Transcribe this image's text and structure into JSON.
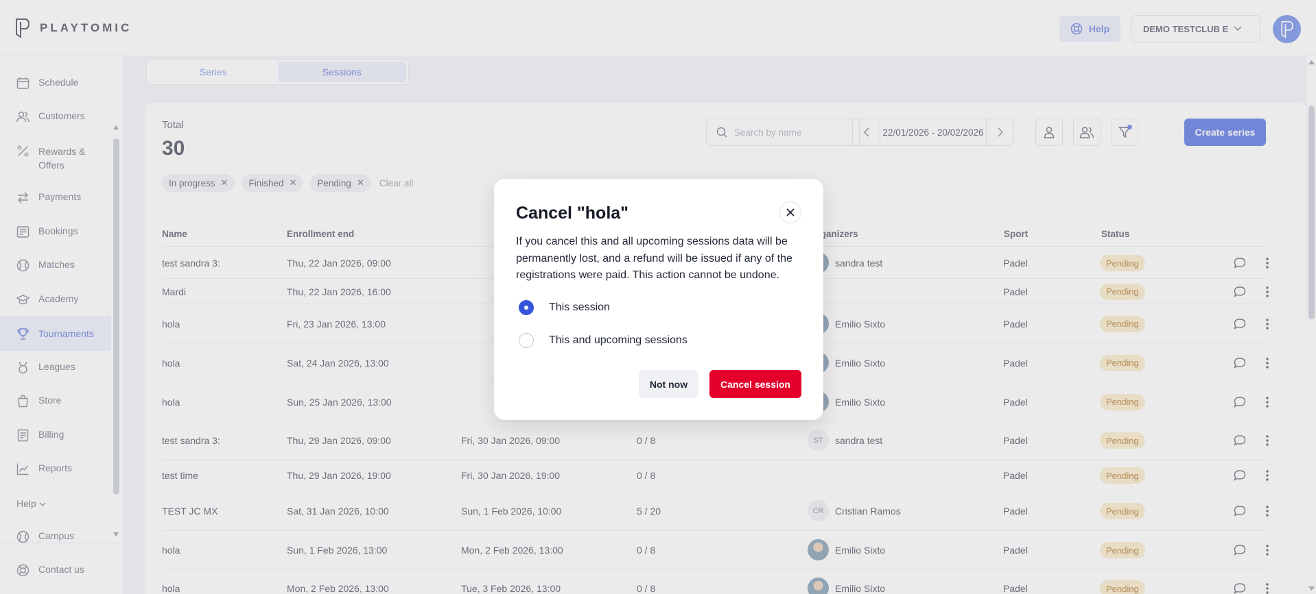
{
  "brand": {
    "name": "PLAYTOMIC"
  },
  "header": {
    "help_label": "Help",
    "club_label": "DEMO TESTCLUB E"
  },
  "sidebar": {
    "items": [
      {
        "label": "Schedule",
        "icon": "calendar-icon"
      },
      {
        "label": "Customers",
        "icon": "users-icon"
      },
      {
        "label": "Rewards &\nOffers",
        "icon": "percent-icon"
      },
      {
        "label": "Payments",
        "icon": "transfer-icon"
      },
      {
        "label": "Bookings",
        "icon": "bookings-icon"
      },
      {
        "label": "Matches",
        "icon": "ball-icon"
      },
      {
        "label": "Academy",
        "icon": "academy-icon"
      },
      {
        "label": "Tournaments",
        "icon": "trophy-icon"
      },
      {
        "label": "Leagues",
        "icon": "medal-icon"
      },
      {
        "label": "Store",
        "icon": "bag-icon"
      },
      {
        "label": "Billing",
        "icon": "billing-icon"
      },
      {
        "label": "Reports",
        "icon": "chart-icon"
      }
    ],
    "active_item": "Tournaments",
    "help_section": "Help",
    "bottom_items": [
      {
        "label": "Campus",
        "icon": "campus-icon"
      },
      {
        "label": "Contact us",
        "icon": "lifebuoy-icon"
      }
    ]
  },
  "tabs": [
    {
      "label": "Series"
    },
    {
      "label": "Sessions",
      "active": true
    }
  ],
  "summary": {
    "total_label": "Total",
    "total_value": "30"
  },
  "filters": {
    "chips": [
      "In progress",
      "Finished",
      "Pending"
    ],
    "clear_label": "Clear all"
  },
  "toolbar": {
    "search_placeholder": "Search by name",
    "date_range": "22/01/2026 - 20/02/2026",
    "create_label": "Create series"
  },
  "table": {
    "columns": [
      "Name",
      "Enrollment end",
      "Organizers",
      "Sport",
      "Status"
    ],
    "rows": [
      {
        "name": "test sandra 3:",
        "enrollment_end": "Thu, 22 Jan 2026, 09:00",
        "start": "",
        "players": "",
        "organizer": "sandra test",
        "organizer_initials": "",
        "sport": "Padel",
        "status": "Pending"
      },
      {
        "name": "Mardi",
        "enrollment_end": "Thu, 22 Jan 2026, 16:00",
        "start": "",
        "players": "",
        "organizer": "",
        "organizer_initials": "",
        "sport": "Padel",
        "status": "Pending"
      },
      {
        "name": "hola",
        "enrollment_end": "Fri, 23 Jan 2026, 13:00",
        "start": "",
        "players": "",
        "organizer": "Emilio Sixto",
        "organizer_initials": "",
        "sport": "Padel",
        "status": "Pending"
      },
      {
        "name": "hola",
        "enrollment_end": "Sat, 24 Jan 2026, 13:00",
        "start": "",
        "players": "",
        "organizer": "Emilio Sixto",
        "organizer_initials": "",
        "sport": "Padel",
        "status": "Pending"
      },
      {
        "name": "hola",
        "enrollment_end": "Sun, 25 Jan 2026, 13:00",
        "start": "",
        "players": "",
        "organizer": "Emilio Sixto",
        "organizer_initials": "",
        "sport": "Padel",
        "status": "Pending"
      },
      {
        "name": "test sandra 3:",
        "enrollment_end": "Thu, 29 Jan 2026, 09:00",
        "start": "Fri, 30 Jan 2026, 09:00",
        "players": "0 / 8",
        "organizer": "sandra test",
        "organizer_initials": "ST",
        "sport": "Padel",
        "status": "Pending"
      },
      {
        "name": "test time",
        "enrollment_end": "Thu, 29 Jan 2026, 19:00",
        "start": "Fri, 30 Jan 2026, 19:00",
        "players": "0 / 8",
        "organizer": "",
        "organizer_initials": "",
        "sport": "Padel",
        "status": "Pending"
      },
      {
        "name": "TEST JC MX",
        "enrollment_end": "Sat, 31 Jan 2026, 10:00",
        "start": "Sun, 1 Feb 2026, 10:00",
        "players": "5 / 20",
        "organizer": "Cristian Ramos",
        "organizer_initials": "CR",
        "sport": "Padel",
        "status": "Pending"
      },
      {
        "name": "hola",
        "enrollment_end": "Sun, 1 Feb 2026, 13:00",
        "start": "Mon, 2 Feb 2026, 13:00",
        "players": "0 / 8",
        "organizer": "Emilio Sixto",
        "organizer_initials": "",
        "sport": "Padel",
        "status": "Pending"
      },
      {
        "name": "hola",
        "enrollment_end": "Mon, 2 Feb 2026, 13:00",
        "start": "Tue, 3 Feb 2026, 13:00",
        "players": "0 / 8",
        "organizer": "Emilio Sixto",
        "organizer_initials": "",
        "sport": "Padel",
        "status": "Pending"
      }
    ]
  },
  "modal": {
    "title": "Cancel \"hola\"",
    "body": "If you cancel this and all upcoming sessions data will be permanently lost, and a refund will be issued if any of the registrations were paid. This action cannot be undone.",
    "options": [
      {
        "label": "This session",
        "selected": true
      },
      {
        "label": "This and upcoming sessions",
        "selected": false
      }
    ],
    "secondary_label": "Not now",
    "primary_label": "Cancel session"
  },
  "colors": {
    "accent": "#3d5de0",
    "danger": "#e5002b",
    "pending_bg": "#fbe7c2",
    "pending_text": "#a66a10"
  }
}
